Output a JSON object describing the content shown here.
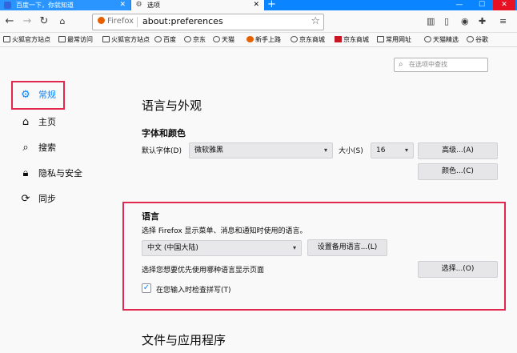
{
  "tabs": [
    {
      "label": "百度一下，你就知道"
    },
    {
      "label": "选项"
    }
  ],
  "window_controls": {
    "minimize": "—",
    "maximize": "☐",
    "close": "✕"
  },
  "urlbar": {
    "badge": "Firefox",
    "url": "about:preferences"
  },
  "bookmarks": [
    {
      "label": "火狐官方站点",
      "icon": "folder"
    },
    {
      "label": "最常访问",
      "icon": "folder"
    },
    {
      "label": "火狐官方站点",
      "icon": "folder"
    },
    {
      "label": "百度",
      "icon": "globe"
    },
    {
      "label": "京东",
      "icon": "globe"
    },
    {
      "label": "天猫",
      "icon": "globe"
    },
    {
      "label": "新手上路",
      "icon": "firefox"
    },
    {
      "label": "京东商城",
      "icon": "globe"
    },
    {
      "label": "京东商城",
      "icon": "jd"
    },
    {
      "label": "常用网址",
      "icon": "folder"
    },
    {
      "label": "天猫精选",
      "icon": "globe"
    },
    {
      "label": "谷歌",
      "icon": "globe"
    }
  ],
  "search": {
    "placeholder": "在选项中查找"
  },
  "sidebar": {
    "items": [
      {
        "label": "常规",
        "icon": "gear-icon"
      },
      {
        "label": "主页",
        "icon": "home-icon"
      },
      {
        "label": "搜索",
        "icon": "search-icon"
      },
      {
        "label": "隐私与安全",
        "icon": "lock-icon"
      },
      {
        "label": "同步",
        "icon": "sync-icon"
      }
    ]
  },
  "main": {
    "section_title": "语言与外观",
    "fonts": {
      "heading": "字体和颜色",
      "default_font_label": "默认字体(D)",
      "default_font_value": "微软雅黑",
      "size_label": "大小(S)",
      "size_value": "16",
      "advanced_button": "高级...(A)",
      "colors_button": "颜色...(C)"
    },
    "language": {
      "heading": "语言",
      "description": "选择 Firefox 显示菜单、消息和通知时使用的语言。",
      "language_value": "中文 (中国大陆)",
      "alternatives_button": "设置备用语言...(L)",
      "page_language_label": "选择您想要优先使用哪种语言显示页面",
      "choose_button": "选择...(O)",
      "spellcheck_label": "在您输入时检查拼写(T)",
      "spellcheck_checked": true
    },
    "next_section_title": "文件与应用程序"
  },
  "colors": {
    "accent": "#0a84ff",
    "highlight": "#e22850",
    "tabbar": "#0a84ff"
  }
}
